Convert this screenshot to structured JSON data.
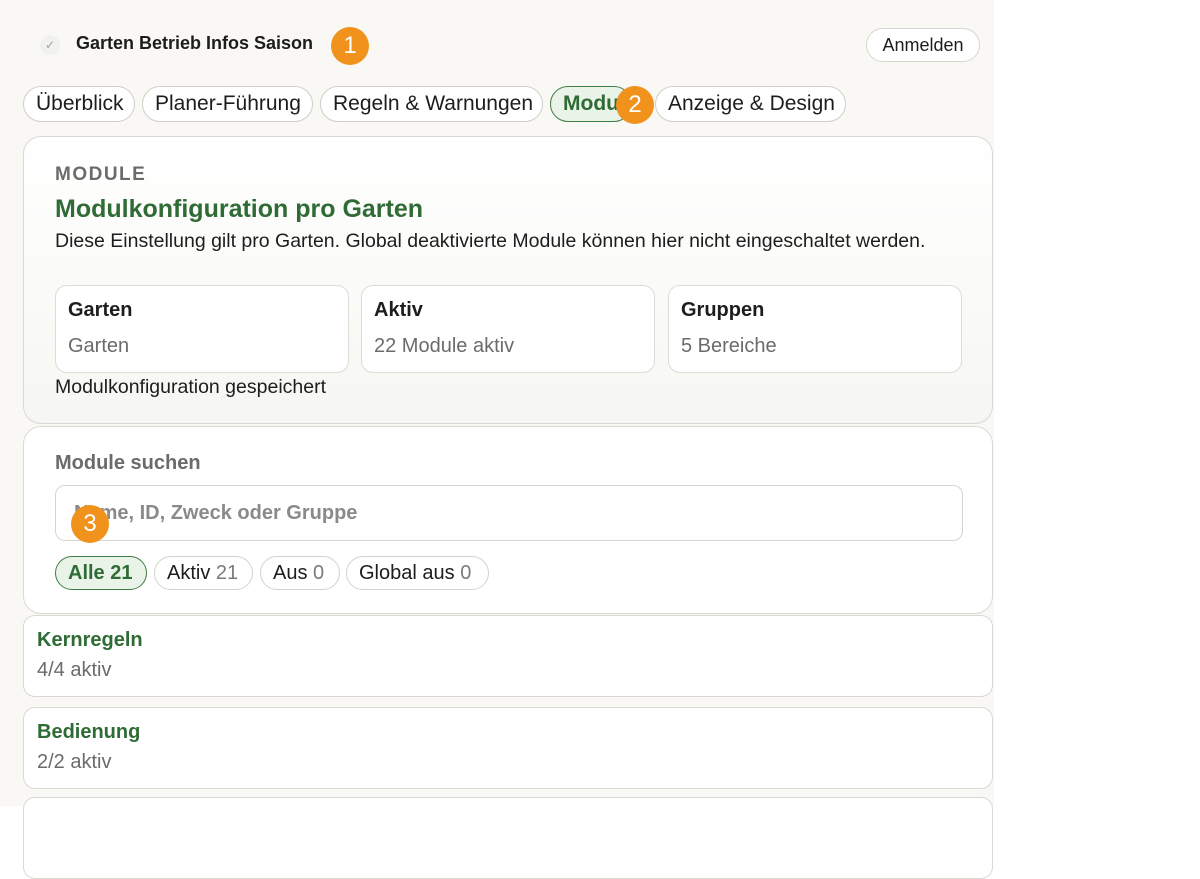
{
  "header": {
    "title": "Garten Betrieb Infos Saison",
    "login_label": "Anmelden"
  },
  "tabs": [
    {
      "label": "Überblick",
      "active": false
    },
    {
      "label": "Planer-Führung",
      "active": false
    },
    {
      "label": "Regeln & Warnungen",
      "active": false
    },
    {
      "label": "Module",
      "active": true
    },
    {
      "label": "Anzeige & Design",
      "active": false
    }
  ],
  "badges": [
    "1",
    "2",
    "3"
  ],
  "hero": {
    "eyebrow": "MODULE",
    "title": "Modulkonfiguration pro Garten",
    "description": "Diese Einstellung gilt pro Garten. Global deaktivierte Module können hier nicht eingeschaltet werden.",
    "stats": [
      {
        "label": "Garten",
        "value": "Garten"
      },
      {
        "label": "Aktiv",
        "value": "22 Module aktiv"
      },
      {
        "label": "Gruppen",
        "value": "5 Bereiche"
      }
    ],
    "status": "Modulkonfiguration gespeichert"
  },
  "search": {
    "label": "Module suchen",
    "placeholder": "Name, ID, Zweck oder Gruppe",
    "value": ""
  },
  "filters": [
    {
      "label": "Alle",
      "count": "21",
      "active": true
    },
    {
      "label": "Aktiv",
      "count": "21",
      "active": false
    },
    {
      "label": "Aus",
      "count": "0",
      "active": false
    },
    {
      "label": "Global aus",
      "count": "0",
      "active": false
    }
  ],
  "groups": [
    {
      "name": "Kernregeln",
      "status": "4/4 aktiv"
    },
    {
      "name": "Bedienung",
      "status": "2/2 aktiv"
    }
  ],
  "colors": {
    "accent": "#2f6b35",
    "badge": "#f0921c",
    "active_chip_bg": "#e9f3e8"
  }
}
